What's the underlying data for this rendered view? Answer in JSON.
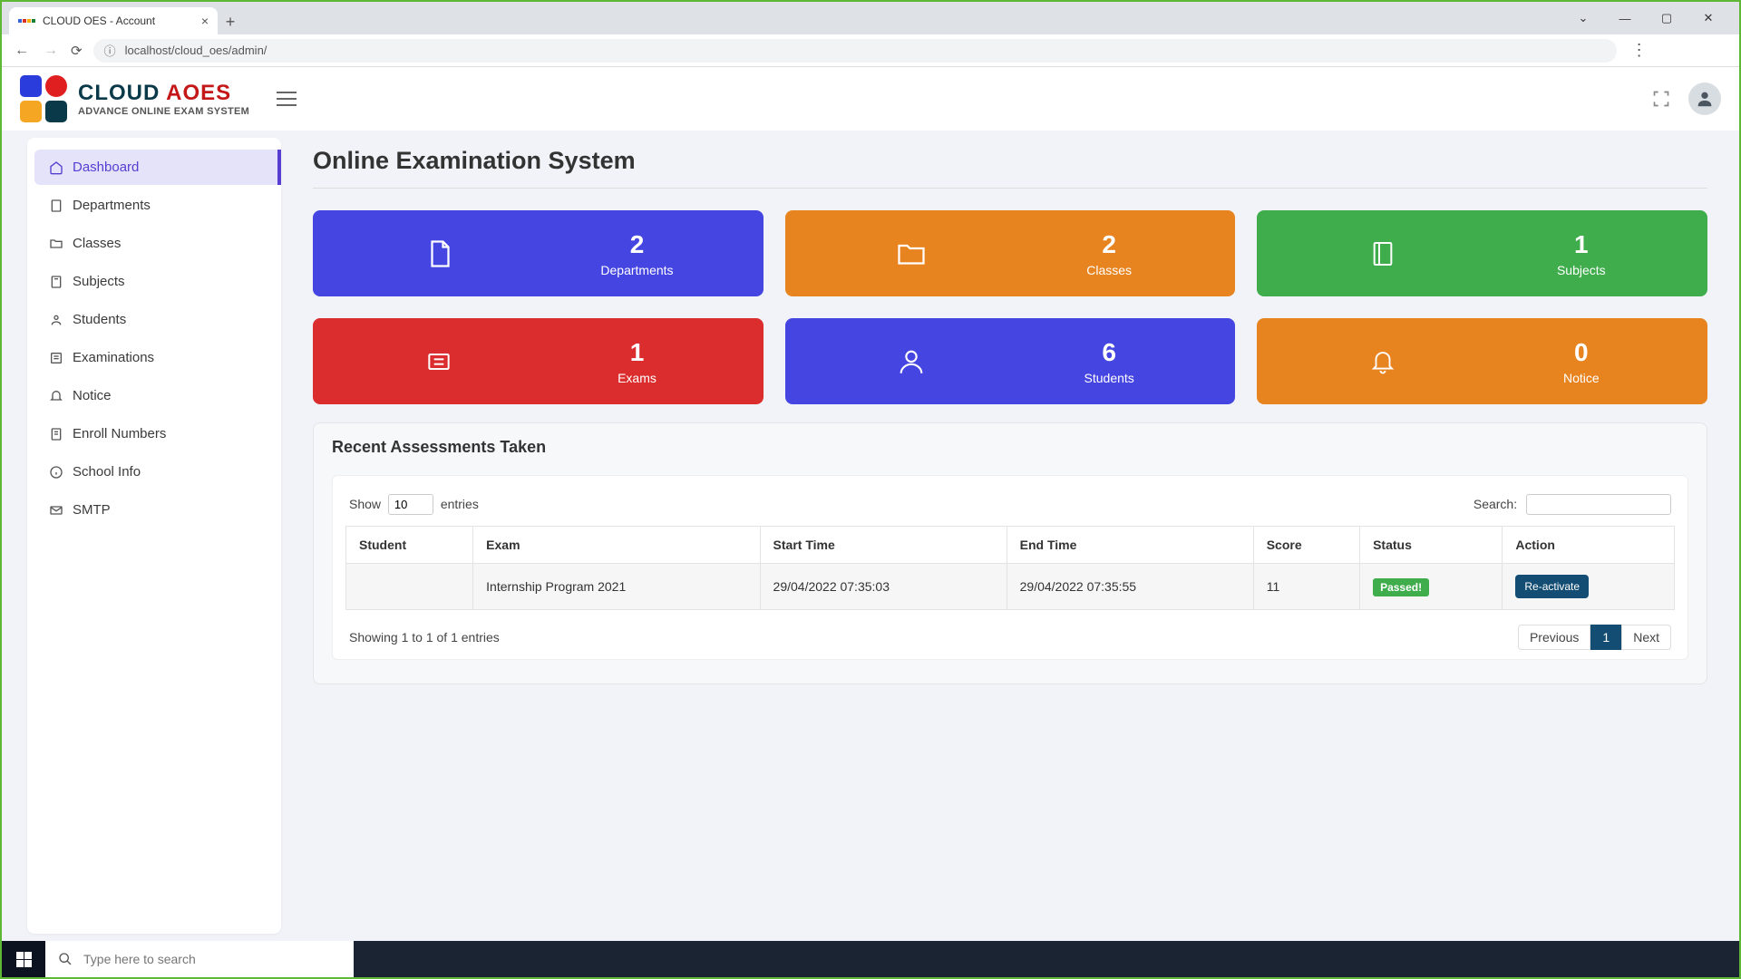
{
  "browser": {
    "tab_title": "CLOUD OES - Account",
    "url": "localhost/cloud_oes/admin/"
  },
  "logo": {
    "line1_a": "CLOUD ",
    "line1_b": "AOES",
    "line2": "ADVANCE ONLINE EXAM SYSTEM"
  },
  "sidebar": {
    "items": [
      {
        "label": "Dashboard"
      },
      {
        "label": "Departments"
      },
      {
        "label": "Classes"
      },
      {
        "label": "Subjects"
      },
      {
        "label": "Students"
      },
      {
        "label": "Examinations"
      },
      {
        "label": "Notice"
      },
      {
        "label": "Enroll Numbers"
      },
      {
        "label": "School Info"
      },
      {
        "label": "SMTP"
      }
    ]
  },
  "page_title": "Online Examination System",
  "cards": [
    {
      "count": "2",
      "label": "Departments"
    },
    {
      "count": "2",
      "label": "Classes"
    },
    {
      "count": "1",
      "label": "Subjects"
    },
    {
      "count": "1",
      "label": "Exams"
    },
    {
      "count": "6",
      "label": "Students"
    },
    {
      "count": "0",
      "label": "Notice"
    }
  ],
  "panel": {
    "title": "Recent Assessments Taken",
    "show_label_pre": "Show",
    "show_value": "10",
    "show_label_post": "entries",
    "search_label": "Search:",
    "columns": [
      "Student",
      "Exam",
      "Start Time",
      "End Time",
      "Score",
      "Status",
      "Action"
    ],
    "row": {
      "student": "",
      "exam": "Internship Program 2021",
      "start": "29/04/2022 07:35:03",
      "end": "29/04/2022 07:35:55",
      "score": "11",
      "status": "Passed!",
      "action": "Re-activate"
    },
    "info": "Showing 1 to 1 of 1 entries",
    "pager": {
      "prev": "Previous",
      "page": "1",
      "next": "Next"
    }
  },
  "taskbar": {
    "search_placeholder": "Type here to search"
  }
}
